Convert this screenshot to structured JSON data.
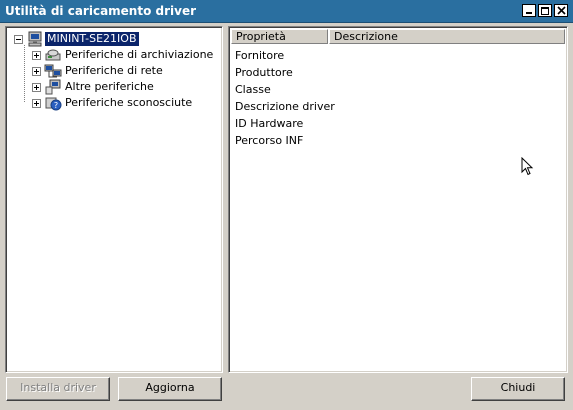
{
  "window": {
    "title": "Utilità di caricamento driver"
  },
  "tree": {
    "root": {
      "label": "MININT-SE21IOB",
      "icon": "computer-icon"
    },
    "children": [
      {
        "label": "Periferiche di archiviazione",
        "icon": "storage-icon"
      },
      {
        "label": "Periferiche di rete",
        "icon": "network-icon"
      },
      {
        "label": "Altre periferiche",
        "icon": "device-icon"
      },
      {
        "label": "Periferiche sconosciute",
        "icon": "unknown-device-icon"
      }
    ]
  },
  "properties": {
    "columns": [
      "Proprietà",
      "Descrizione"
    ],
    "rows": [
      "Fornitore",
      "Produttore",
      "Classe",
      "Descrizione driver",
      "ID Hardware",
      "Percorso INF"
    ]
  },
  "buttons": {
    "install": "Installa driver",
    "refresh": "Aggiorna",
    "close": "Chiudi"
  },
  "colors": {
    "titlebar": "#2a6fa0",
    "selection": "#0a246a",
    "face": "#d4d0c8"
  }
}
